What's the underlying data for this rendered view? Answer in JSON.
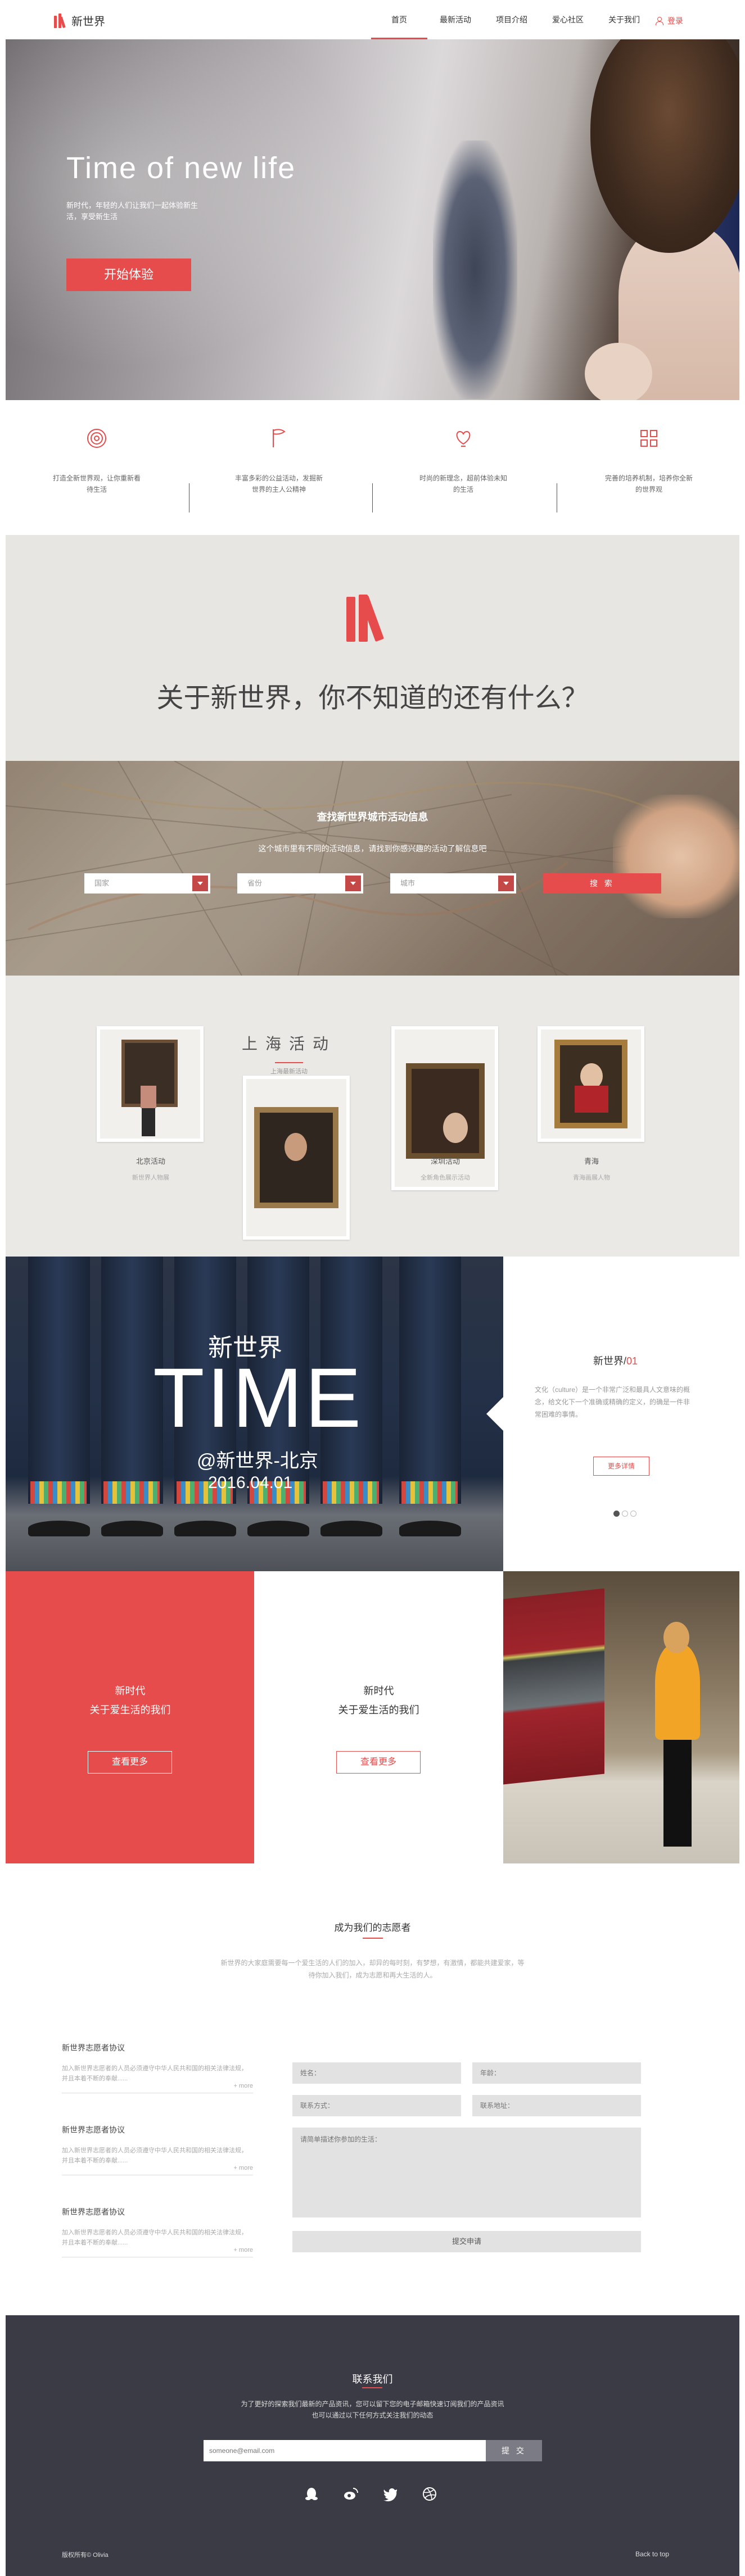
{
  "header": {
    "logo_text": "新世界",
    "nav": [
      {
        "label": "首页",
        "active": true
      },
      {
        "label": "最新活动",
        "active": false
      },
      {
        "label": "项目介绍",
        "active": false
      },
      {
        "label": "爱心社区",
        "active": false
      },
      {
        "label": "关于我们",
        "active": false
      }
    ],
    "login_label": "登录"
  },
  "hero": {
    "title": "Time of new life",
    "subtitle": "新时代，年轻的人们让我们一起体验新生活，享受新生活",
    "cta_label": "开始体验"
  },
  "features": [
    {
      "icon": "target-icon",
      "text": "打造全新世界观，让你重新看待生活"
    },
    {
      "icon": "flag-icon",
      "text": "丰富多彩的公益活动，发掘新世界的主人公精神"
    },
    {
      "icon": "heart-bulb-icon",
      "text": "时尚的新理念，超前体验未知的生活"
    },
    {
      "icon": "grid-icon",
      "text": "完善的培养机制，培养你全新的世界观"
    }
  ],
  "about": {
    "title": "关于新世界，你不知道的还有什么？"
  },
  "search": {
    "title": "查找新世界城市活动信息",
    "subtitle": "这个城市里有不同的活动信息，请找到你感兴趣的活动了解信息吧",
    "selects": [
      {
        "placeholder": "国家"
      },
      {
        "placeholder": "省份"
      },
      {
        "placeholder": "城市"
      }
    ],
    "button_label": "搜  索"
  },
  "activities": {
    "title": "上海活动",
    "subtitle": "上海最新活动",
    "cards": [
      {
        "title": "北京活动",
        "desc": "新世界人物展"
      },
      {
        "title": "深圳活动",
        "desc": "全新角色展示活动"
      },
      {
        "title": "青海",
        "desc": "青海画展人物"
      }
    ]
  },
  "time_section": {
    "overlay_small": "新世界",
    "overlay_big": "TIME",
    "overlay_at": "@新世界-北京",
    "overlay_date": "2016.04.01",
    "side_title": "新世界/",
    "side_num": "01",
    "side_body": "文化（culture）是一个非常广泛和最具人文意味的概念，给文化下一个准确或精确的定义，的确是一件非常困难的事情。",
    "side_button": "更多详情",
    "dots": [
      true,
      false,
      false
    ]
  },
  "promo": {
    "red": {
      "line1": "新时代",
      "line2": "关于爱生活的我们",
      "button": "查看更多"
    },
    "white": {
      "line1": "新时代",
      "line2": "关于爱生活的我们",
      "button": "查看更多"
    }
  },
  "volunteer": {
    "title": "成为我们的志愿者",
    "description": "新世界的大家庭需要每一个爱生活的人们的加入，却异的每时刻，有梦想，有激情，都能共建爱家，等待你加入我们，成为志愿和再大生活的人。",
    "agreements": [
      {
        "title": "新世界志愿者协议",
        "body": "加入新世界志愿者的人员必须遵守中华人民共和国的相关法律法规，并且本着不断的奉献......",
        "more": "+ more"
      },
      {
        "title": "新世界志愿者协议",
        "body": "加入新世界志愿者的人员必须遵守中华人民共和国的相关法律法规，并且本着不断的奉献......",
        "more": "+ more"
      },
      {
        "title": "新世界志愿者协议",
        "body": "加入新世界志愿者的人员必须遵守中华人民共和国的相关法律法规，并且本着不断的奉献......",
        "more": "+ more"
      }
    ],
    "form": {
      "name": "姓名：",
      "age": "年龄：",
      "contact": "联系方式：",
      "address": "联系地址：",
      "message": "请简单描述你参加的生活：",
      "submit": "提交申请"
    }
  },
  "footer": {
    "title": "联系我们",
    "desc_line1": "为了更好的探索我们最新的产品资讯，您可以留下您的电子邮箱快速订阅我们的产品资讯",
    "desc_line2": "也可以通过以下任何方式关注我们的动态",
    "email_placeholder": "someone@email.com",
    "send_label": "提 交",
    "social": [
      "qq-icon",
      "weibo-icon",
      "twitter-icon",
      "dribbble-icon"
    ],
    "copyright": "版权所有© Olivia",
    "back_to_top": "Back to top"
  },
  "colors": {
    "accent": "#e74c4c",
    "footer_bg": "#3a3b45",
    "section_gray": "#e8e6e3"
  }
}
